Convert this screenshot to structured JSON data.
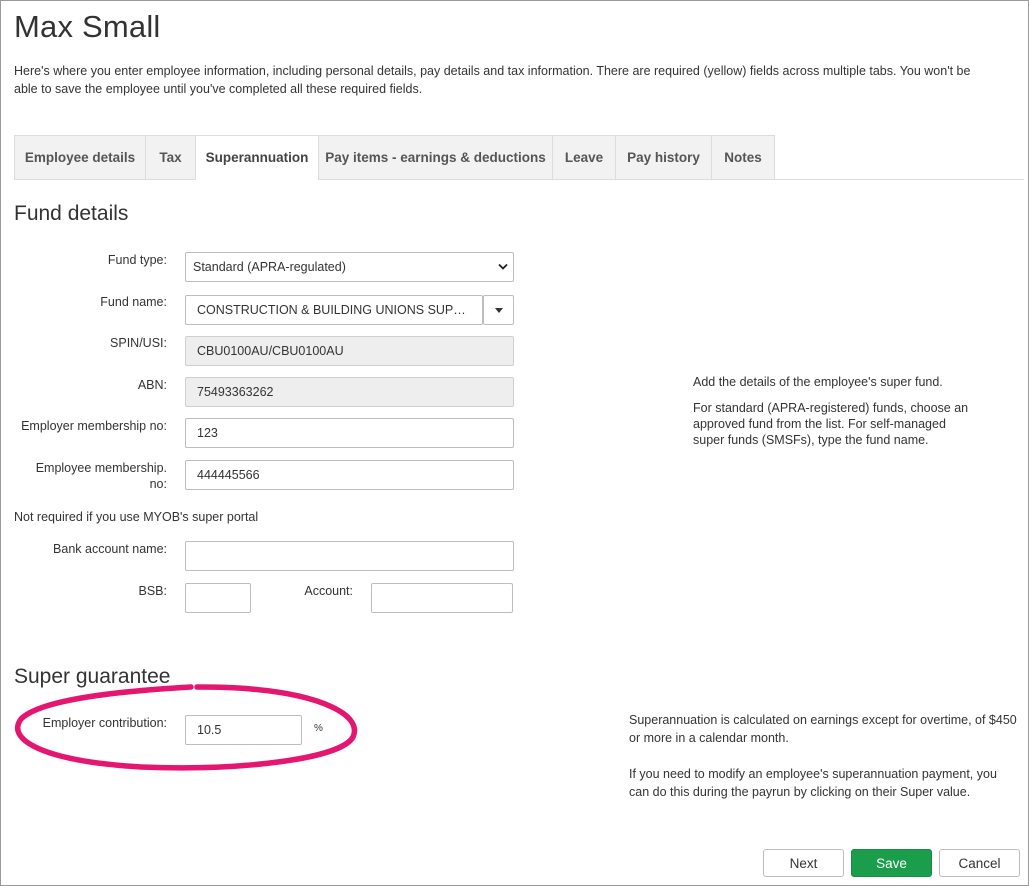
{
  "page": {
    "title": "Max Small",
    "intro": "Here's where you enter employee information, including personal details, pay details and tax information. There are required (yellow) fields across multiple tabs. You won't be able to save the employee until you've completed all these required fields."
  },
  "tabs": [
    {
      "label": "Employee details",
      "active": false
    },
    {
      "label": "Tax",
      "active": false
    },
    {
      "label": "Superannuation",
      "active": true
    },
    {
      "label": "Pay items - earnings & deductions",
      "active": false
    },
    {
      "label": "Leave",
      "active": false
    },
    {
      "label": "Pay history",
      "active": false
    },
    {
      "label": "Notes",
      "active": false
    }
  ],
  "fund_details": {
    "title": "Fund details",
    "fund_type": {
      "label": "Fund type:",
      "value": "Standard (APRA-regulated)"
    },
    "fund_name": {
      "label": "Fund name:",
      "value": "CONSTRUCTION & BUILDING UNIONS SUP…"
    },
    "spin_usi": {
      "label": "SPIN/USI:",
      "value": "CBU0100AU/CBU0100AU"
    },
    "abn": {
      "label": "ABN:",
      "value": "75493363262"
    },
    "employer_membership": {
      "label": "Employer membership no:",
      "value": "123"
    },
    "employee_membership": {
      "label_line1": "Employee membership.",
      "label_line2": "no:",
      "value": "444445566"
    },
    "note": "Not required if you use MYOB's super portal",
    "bank_account_name": {
      "label": "Bank account name:",
      "value": ""
    },
    "bsb": {
      "label": "BSB:",
      "value": ""
    },
    "account": {
      "label": "Account:",
      "value": ""
    },
    "help_line1": "Add the details of the employee's super fund.",
    "help_line2": "For standard (APRA-registered) funds, choose an",
    "help_line3": "approved fund from the list. For self-managed",
    "help_line4": "super funds (SMSFs), type the fund name."
  },
  "super_guarantee": {
    "title": "Super guarantee",
    "employer_contribution": {
      "label": "Employer contribution:",
      "value": "10.5",
      "unit": "%"
    },
    "help_line1": "Superannuation is calculated on earnings except for overtime, of $450",
    "help_line2": "or more in a calendar month.",
    "help_line3": "If you need to modify an employee's superannuation payment, you",
    "help_line4": "can do this during the payrun by clicking on their Super value."
  },
  "actions": {
    "next": "Next",
    "save": "Save",
    "cancel": "Cancel"
  },
  "colors": {
    "primary": "#1a9e4b",
    "annotation": "#e5166f"
  }
}
